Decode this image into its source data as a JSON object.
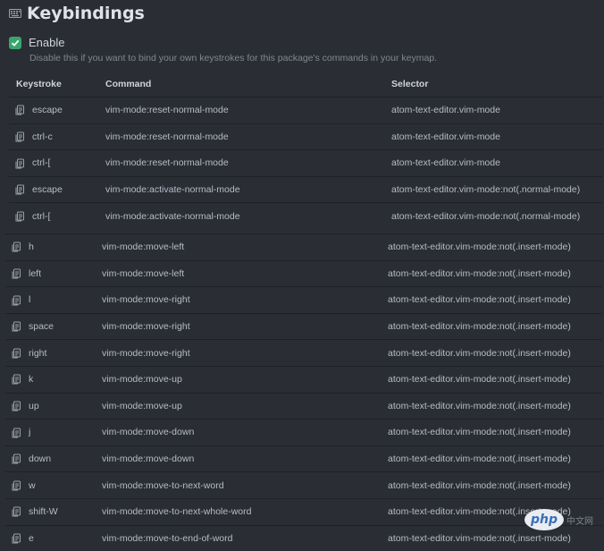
{
  "header": {
    "title": "Keybindings",
    "icon": "keyboard-icon"
  },
  "enable": {
    "label": "Enable",
    "checked": true,
    "description": "Disable this if you want to bind your own keystrokes for this package's commands in your keymap."
  },
  "table": {
    "columns": [
      "Keystroke",
      "Command",
      "Selector"
    ],
    "rows_group1": [
      {
        "keystroke": "escape",
        "command": "vim-mode:reset-normal-mode",
        "selector": "atom-text-editor.vim-mode"
      },
      {
        "keystroke": "ctrl-c",
        "command": "vim-mode:reset-normal-mode",
        "selector": "atom-text-editor.vim-mode"
      },
      {
        "keystroke": "ctrl-[",
        "command": "vim-mode:reset-normal-mode",
        "selector": "atom-text-editor.vim-mode"
      },
      {
        "keystroke": "escape",
        "command": "vim-mode:activate-normal-mode",
        "selector": "atom-text-editor.vim-mode:not(.normal-mode)"
      },
      {
        "keystroke": "ctrl-[",
        "command": "vim-mode:activate-normal-mode",
        "selector": "atom-text-editor.vim-mode:not(.normal-mode)"
      }
    ],
    "rows_group2": [
      {
        "keystroke": "h",
        "command": "vim-mode:move-left",
        "selector": "atom-text-editor.vim-mode:not(.insert-mode)"
      },
      {
        "keystroke": "left",
        "command": "vim-mode:move-left",
        "selector": "atom-text-editor.vim-mode:not(.insert-mode)"
      },
      {
        "keystroke": "l",
        "command": "vim-mode:move-right",
        "selector": "atom-text-editor.vim-mode:not(.insert-mode)"
      },
      {
        "keystroke": "space",
        "command": "vim-mode:move-right",
        "selector": "atom-text-editor.vim-mode:not(.insert-mode)"
      },
      {
        "keystroke": "right",
        "command": "vim-mode:move-right",
        "selector": "atom-text-editor.vim-mode:not(.insert-mode)"
      },
      {
        "keystroke": "k",
        "command": "vim-mode:move-up",
        "selector": "atom-text-editor.vim-mode:not(.insert-mode)"
      },
      {
        "keystroke": "up",
        "command": "vim-mode:move-up",
        "selector": "atom-text-editor.vim-mode:not(.insert-mode)"
      },
      {
        "keystroke": "j",
        "command": "vim-mode:move-down",
        "selector": "atom-text-editor.vim-mode:not(.insert-mode)"
      },
      {
        "keystroke": "down",
        "command": "vim-mode:move-down",
        "selector": "atom-text-editor.vim-mode:not(.insert-mode)"
      },
      {
        "keystroke": "w",
        "command": "vim-mode:move-to-next-word",
        "selector": "atom-text-editor.vim-mode:not(.insert-mode)"
      },
      {
        "keystroke": "shift-W",
        "command": "vim-mode:move-to-next-whole-word",
        "selector": "atom-text-editor.vim-mode:not(.insert-mode)"
      },
      {
        "keystroke": "e",
        "command": "vim-mode:move-to-end-of-word",
        "selector": "atom-text-editor.vim-mode:not(.insert-mode)"
      }
    ]
  },
  "watermark": {
    "logo": "php",
    "text": "中文网"
  },
  "colors": {
    "background": "#2a2e34",
    "checkbox": "#3aa56b",
    "text": "#b6bcc6"
  }
}
